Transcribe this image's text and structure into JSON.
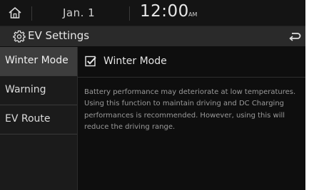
{
  "status_bar": {
    "date": "Jan.  1",
    "time": "12:00",
    "ampm": "AM",
    "home_icon": "home-icon"
  },
  "header": {
    "title": "EV Settings",
    "settings_icon": "gear-icon",
    "back_icon": "back-arrow-icon"
  },
  "sidebar": {
    "items": [
      {
        "label": "Winter Mode",
        "active": true
      },
      {
        "label": "Warning",
        "active": false
      },
      {
        "label": "EV Route",
        "active": false
      }
    ]
  },
  "main": {
    "option": {
      "label": "Winter Mode",
      "checked": true
    },
    "description": "Battery performance may deteriorate at low temperatures. Using this function to maintain driving and DC Charging performances is recommended. However, using this will reduce the driving range."
  },
  "colors": {
    "background": "#0e0e0e",
    "header_bar": "#2a2a2a",
    "sidebar": "#1b1b1b",
    "sidebar_active": "#3d3d3d",
    "text": "#e4e4e4",
    "description_text": "#9a9a9a"
  }
}
